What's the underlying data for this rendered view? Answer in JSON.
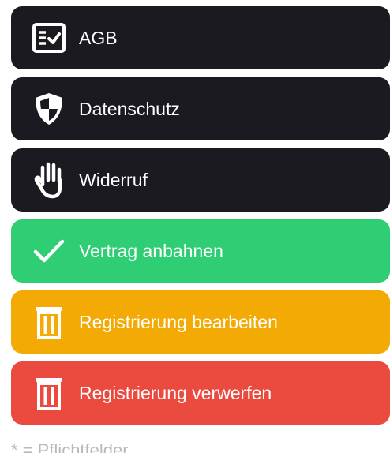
{
  "buttons": {
    "agb": {
      "label": "AGB",
      "icon": "checklist-icon",
      "color": "#1b1a21"
    },
    "datenschutz": {
      "label": "Datenschutz",
      "icon": "shield-icon",
      "color": "#1b1a21"
    },
    "widerruf": {
      "label": "Widerruf",
      "icon": "hand-stop-icon",
      "color": "#1b1a21"
    },
    "vertrag": {
      "label": "Vertrag anbahnen",
      "icon": "checkmark-icon",
      "color": "#2fce74"
    },
    "bearbeiten": {
      "label": "Registrierung bearbeiten",
      "icon": "trash-icon",
      "color": "#f3aa04"
    },
    "verwerfen": {
      "label": "Registrierung verwerfen",
      "icon": "trash-icon",
      "color": "#eb4b3f"
    }
  },
  "footnote": "* = Pflichtfelder"
}
